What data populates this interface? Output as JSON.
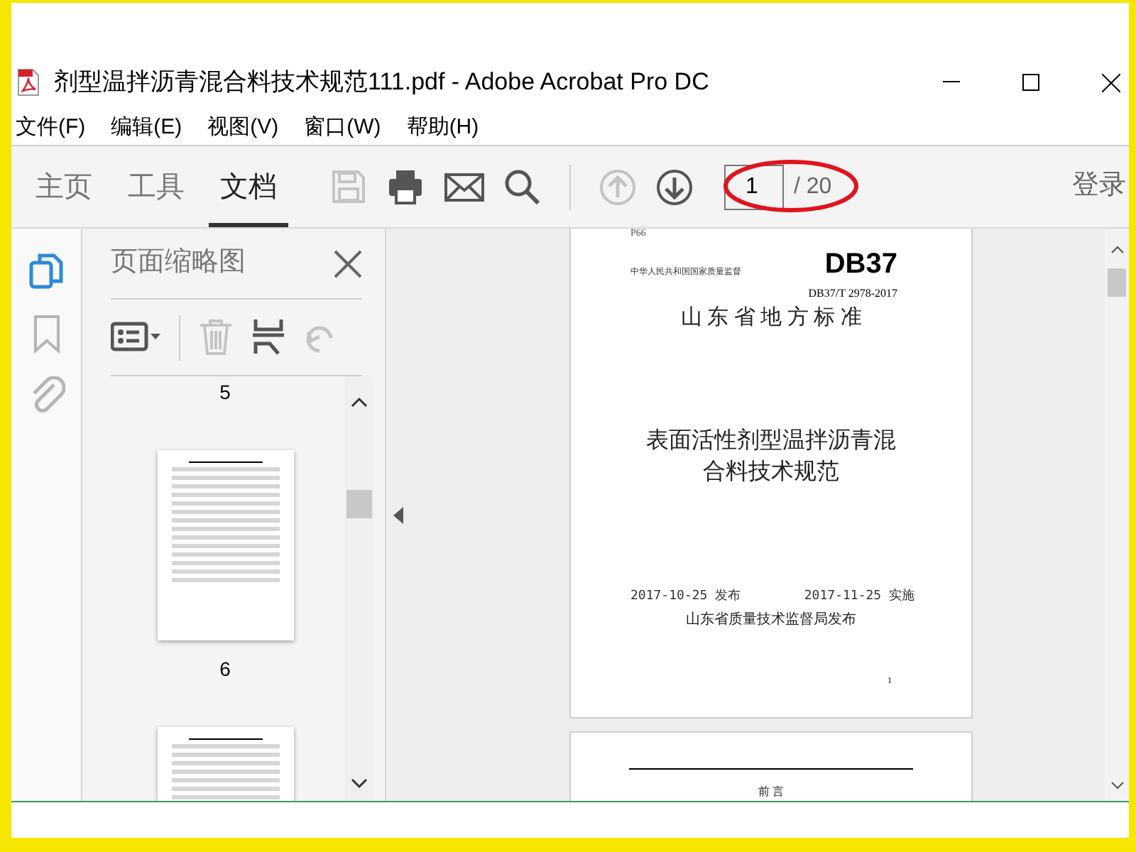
{
  "window": {
    "title": "剂型温拌沥青混合料技术规范111.pdf - Adobe Acrobat Pro DC"
  },
  "menu": [
    "文件(F)",
    "编辑(E)",
    "视图(V)",
    "窗口(W)",
    "帮助(H)"
  ],
  "tabs": [
    {
      "label": "主页",
      "selected": false
    },
    {
      "label": "工具",
      "selected": false
    },
    {
      "label": "文档",
      "selected": true
    }
  ],
  "toolbar": [
    {
      "kind": "save",
      "disabled": true
    },
    {
      "kind": "print",
      "disabled": false
    },
    {
      "kind": "email",
      "disabled": false
    },
    {
      "kind": "search",
      "disabled": false
    },
    {
      "kind": "separator"
    },
    {
      "kind": "prev",
      "disabled": true
    },
    {
      "kind": "next",
      "disabled": false
    }
  ],
  "page_nav": {
    "current": "1",
    "total": "/ 20"
  },
  "sign_in": "登录",
  "rail": [
    {
      "kind": "pages",
      "selected": true
    },
    {
      "kind": "bookmarks",
      "selected": false
    },
    {
      "kind": "attachments",
      "selected": false
    }
  ],
  "panel": {
    "title": "页面缩略图",
    "tools": [
      {
        "kind": "options",
        "disabled": false
      },
      {
        "kind": "delete",
        "disabled": true
      },
      {
        "kind": "insert",
        "disabled": false
      },
      {
        "kind": "undo",
        "disabled": true
      }
    ],
    "thumbnails": [
      {
        "kind": "label_only",
        "label": "5"
      },
      {
        "kind": "page",
        "label": "6"
      },
      {
        "kind": "page"
      }
    ]
  },
  "document": {
    "pages": [
      {
        "kind": "cover",
        "code": "P66",
        "issuer": "中华人民共和国国家质量监督",
        "logo": "DB37",
        "number": "DB37/T 2978-2017",
        "category": "山 东 省 地 方 标 准",
        "title": "表面活性剂型温拌沥青混合料技术规范",
        "issued": "2017-10-25 发布",
        "effective": "2017-11-25 实施",
        "publisher": "山东省质量技术监督局发布",
        "page_number": "1"
      },
      {
        "kind": "foreword",
        "heading": "前 言"
      }
    ]
  }
}
